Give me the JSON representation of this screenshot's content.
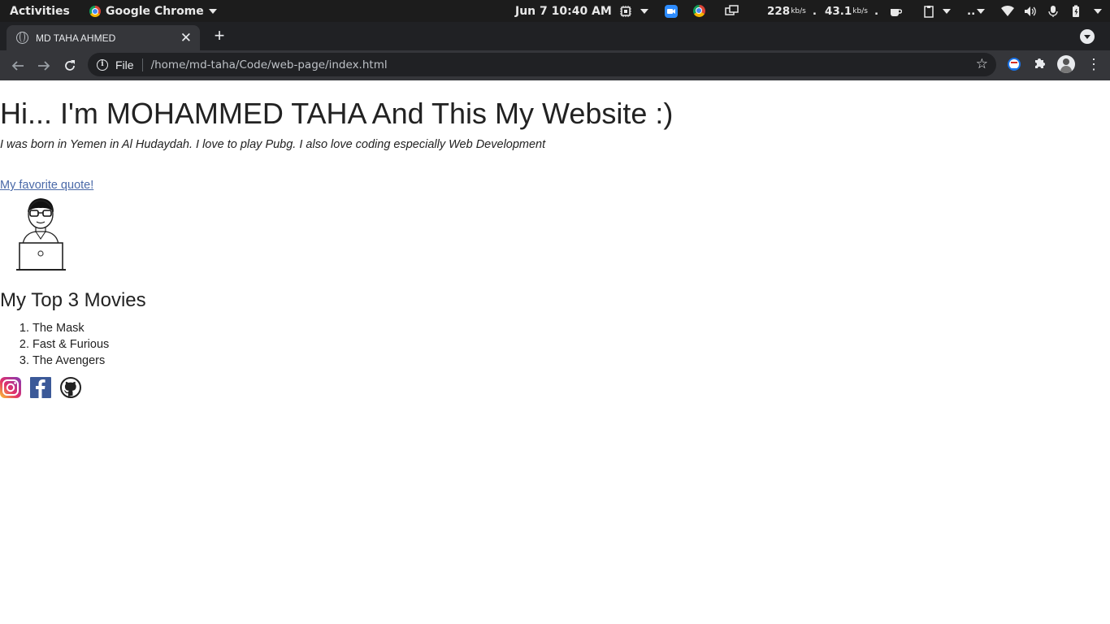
{
  "topbar": {
    "activities": "Activities",
    "app_name": "Google Chrome",
    "clock": "Jun 7  10:40 AM",
    "download_speed": "228",
    "upload_speed": "43.1",
    "speed_unit": "kb/s",
    "ellipsis": ".."
  },
  "tab": {
    "title": "MD TAHA AHMED"
  },
  "omnibox": {
    "scheme_label": "File",
    "url": "/home/md-taha/Code/web-page/index.html"
  },
  "page": {
    "heading": "Hi... I'm MOHAMMED TAHA And This My Website :)",
    "bio": "I was born in Yemen in Al Hudaydah. I love to play Pubg. I also love coding especially Web Development",
    "quote_link": "My favorite quote!",
    "movies_heading": "My Top 3 Movies",
    "movies": [
      "The Mask",
      "Fast & Furious",
      "The Avengers"
    ],
    "socials": [
      "instagram-icon",
      "facebook-icon",
      "github-icon"
    ]
  },
  "colors": {
    "topbar_bg": "#1c1c1c",
    "tabstrip_bg": "#202124",
    "toolbar_bg": "#35363a",
    "link": "#4a69a8",
    "facebook": "#3b5998"
  }
}
